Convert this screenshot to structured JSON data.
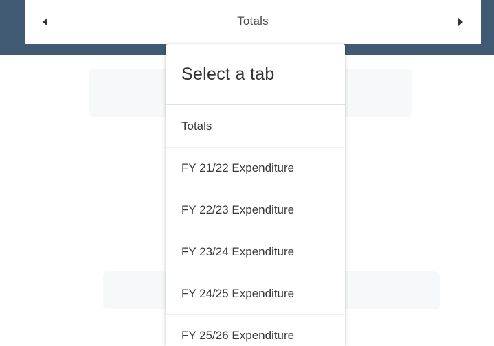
{
  "tab_selector": {
    "current_tab": "Totals",
    "prev_icon": "caret-left-icon",
    "next_icon": "caret-right-icon"
  },
  "dropdown": {
    "title": "Select a tab",
    "items": [
      {
        "label": "Totals"
      },
      {
        "label": "FY 21/22 Expenditure"
      },
      {
        "label": "FY 22/23 Expenditure"
      },
      {
        "label": "FY 23/24 Expenditure"
      },
      {
        "label": "FY 24/25 Expenditure"
      },
      {
        "label": "FY 25/26 Expenditure"
      }
    ]
  },
  "colors": {
    "header_band": "#3f5a72",
    "text": "#3a3a3a"
  }
}
